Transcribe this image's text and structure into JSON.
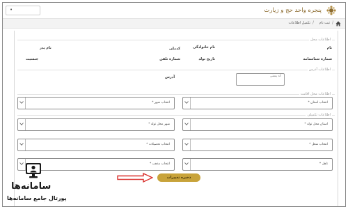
{
  "header": {
    "title": "پنجره واحد حج و زیارت",
    "lang_value": "•"
  },
  "breadcrumb": {
    "home_icon": "home-icon",
    "items": [
      "ثبت نام",
      "تکمیل اطلاعات"
    ]
  },
  "sections": {
    "personal": "اطلاعات محل",
    "address": "اطلاعات آدرس",
    "birth": "اطلاعات محل اقامت",
    "extra": "اطلاعات تکمیلی"
  },
  "personal_fields": {
    "first_name": "نام",
    "last_name": "نام خانوادگی",
    "father_name": "نام پدر",
    "national_id": "شماره شناسنامه",
    "birth_date": "تاریخ تولد",
    "phone": "شماره تلفن",
    "gender": "جنسیت",
    "code": "کدملی"
  },
  "address_fields": {
    "address_label": "آدرس",
    "postal_placeholder": "کد پستی"
  },
  "selects": {
    "province": "انتخاب استان *",
    "city": "انتخاب شهر *",
    "birth_province": "استان محل تولد *",
    "birth_city": "شهر محل تولد *",
    "job": "انتخاب شغل *",
    "education": "انتخاب تحصیلات *",
    "marital": "تاهل *",
    "religion": "انتخاب مذهب *"
  },
  "save_button": "ذخیره تغییرات",
  "watermark": {
    "name": "سامانه‌ها",
    "subtitle": "پورتال جامع سامانه‌ها"
  },
  "colors": {
    "accent": "#c8a33a",
    "arrow": "#d9302c",
    "title": "#8b6a2e"
  }
}
